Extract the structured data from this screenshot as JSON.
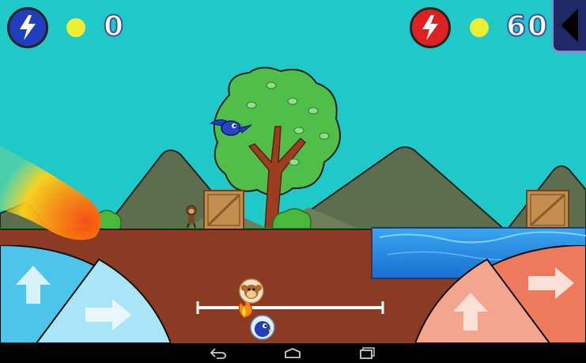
{
  "hud": {
    "player1": {
      "color": "#1f3fbf",
      "score": "0",
      "icon": "lightning-bolt-icon"
    },
    "player2": {
      "color": "#dd2020",
      "score": "60",
      "icon": "lightning-bolt-icon"
    },
    "back_icon": "back-triangle-icon"
  },
  "race_progress": {
    "monkey_position": 0.29,
    "bird_position": 0.35,
    "fire_position": 0.25
  },
  "controls": {
    "left": {
      "up_icon": "arrow-up-icon",
      "right_icon": "arrow-right-icon",
      "color": "#4dc4ea"
    },
    "right": {
      "up_icon": "arrow-up-icon",
      "right_icon": "arrow-right-icon",
      "color": "#ee7a5d"
    }
  },
  "navbar": {
    "back_icon": "nav-back-icon",
    "home_icon": "nav-home-icon",
    "recents_icon": "nav-recents-icon"
  },
  "colors": {
    "sky": "#1fc9c7",
    "ground": "#8a3b22",
    "water": "#1e8ee6",
    "grass": "#3d9c1e"
  }
}
